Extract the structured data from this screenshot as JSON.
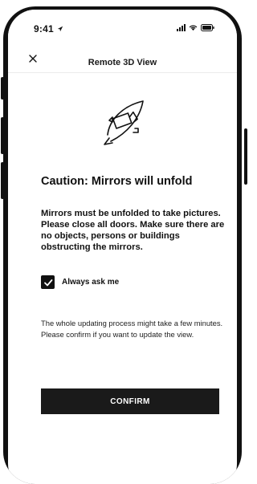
{
  "status_bar": {
    "time": "9:41"
  },
  "header": {
    "title": "Remote 3D View"
  },
  "warning": {
    "title": "Caution: Mirrors will unfold",
    "message": "Mirrors must be unfolded to take pictures. Please close all doors. Make sure there are no objects, persons or buildings obstructing the mirrors."
  },
  "checkbox": {
    "label": "Always ask me",
    "checked": true
  },
  "info_text": "The whole updating process might take a few minutes. Please confirm if you want to update the view.",
  "confirm_button": {
    "label": "CONFIRM"
  },
  "colors": {
    "primary": "#1a1a1a",
    "background": "#ffffff",
    "text": "#111111"
  },
  "icons": [
    "close-icon",
    "camera-rotation-icon",
    "checkmark-icon",
    "location-arrow-icon",
    "cellular-signal-icon",
    "wifi-icon",
    "battery-icon"
  ]
}
